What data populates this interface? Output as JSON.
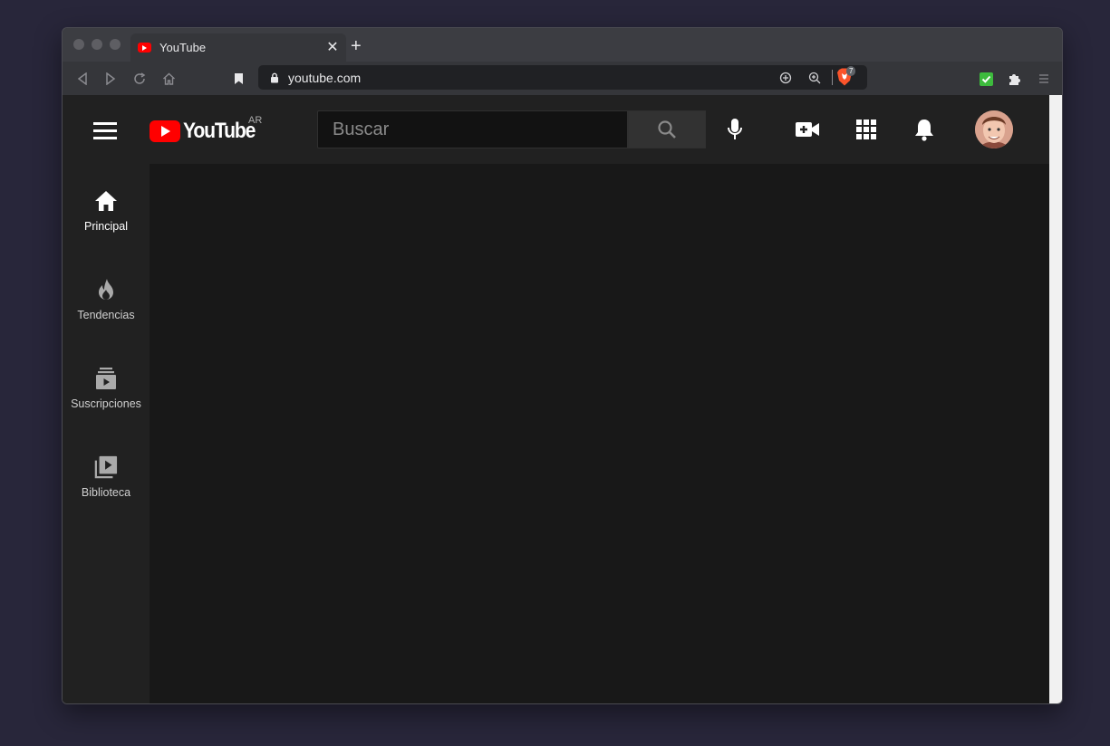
{
  "browser": {
    "tab": {
      "title": "YouTube",
      "close_glyph": "✕",
      "favicon": "youtube-favicon"
    },
    "new_tab_glyph": "+",
    "url": "youtube.com",
    "shields_count": "7"
  },
  "youtube": {
    "logo_text": "YouTube",
    "country_code": "AR",
    "search_placeholder": "Buscar",
    "sidebar": [
      {
        "label": "Principal",
        "icon": "home-icon",
        "active": true
      },
      {
        "label": "Tendencias",
        "icon": "trending-icon",
        "active": false
      },
      {
        "label": "Suscripciones",
        "icon": "subscriptions-icon",
        "active": false
      },
      {
        "label": "Biblioteca",
        "icon": "library-icon",
        "active": false
      }
    ]
  },
  "colors": {
    "youtube_red": "#ff0000",
    "page_bg": "#181818",
    "header_bg": "#212121"
  }
}
